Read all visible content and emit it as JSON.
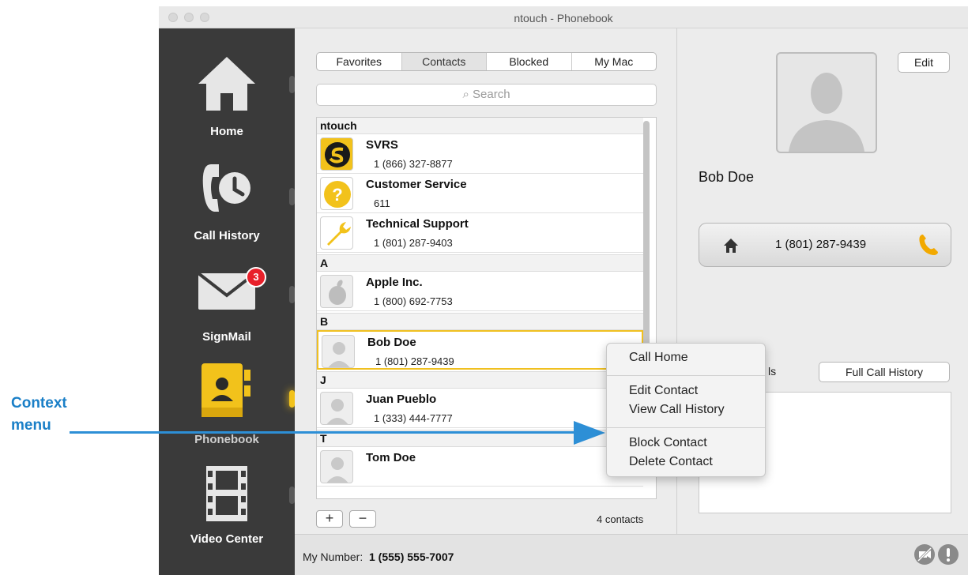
{
  "window": {
    "title": "ntouch - Phonebook"
  },
  "sidebar": {
    "items": [
      {
        "label": "Home",
        "icon": "home-icon"
      },
      {
        "label": "Call History",
        "icon": "call-history-icon"
      },
      {
        "label": "SignMail",
        "icon": "envelope-icon",
        "badge": "3"
      },
      {
        "label": "Phonebook",
        "icon": "phonebook-icon",
        "active": true
      },
      {
        "label": "Video Center",
        "icon": "film-icon"
      }
    ]
  },
  "tabs": [
    "Favorites",
    "Contacts",
    "Blocked",
    "My Mac"
  ],
  "search": {
    "placeholder": "Search",
    "icon": "magnifier-icon"
  },
  "sections": [
    {
      "header": "ntouch",
      "contacts": [
        {
          "name": "SVRS",
          "number": "1 (866) 327-8877",
          "icon": "svrs-logo-icon"
        },
        {
          "name": "Customer Service",
          "number": "611",
          "icon": "question-icon"
        },
        {
          "name": "Technical Support",
          "number": "1 (801) 287-9403",
          "icon": "wrench-icon"
        }
      ]
    },
    {
      "header": "A",
      "contacts": [
        {
          "name": "Apple Inc.",
          "number": "1 (800) 692-7753",
          "icon": "apple-logo-icon"
        }
      ]
    },
    {
      "header": "B",
      "contacts": [
        {
          "name": "Bob Doe",
          "number": "1 (801) 287-9439",
          "icon": "person-silhouette-icon",
          "selected": true
        }
      ]
    },
    {
      "header": "J",
      "contacts": [
        {
          "name": "Juan Pueblo",
          "number": "1 (333) 444-7777",
          "icon": "person-silhouette-icon"
        }
      ]
    },
    {
      "header": "T",
      "contacts": [
        {
          "name": "Tom Doe",
          "number": "",
          "icon": "person-silhouette-icon"
        }
      ]
    }
  ],
  "list_footer": {
    "add": "+",
    "remove": "−",
    "count": "4 contacts"
  },
  "details": {
    "edit": "Edit",
    "name": "Bob Doe",
    "phone_type_icon": "home-icon",
    "phone": "1 (801) 287-9439",
    "calls_label_fragment": "ls",
    "full_call_history": "Full Call History"
  },
  "status": {
    "my_number_label": "My Number:",
    "my_number": "1 (555) 555-7007"
  },
  "context_menu": {
    "items": [
      "Call Home",
      "Edit Contact",
      "View Call History",
      "Block Contact",
      "Delete Contact"
    ]
  },
  "callout": {
    "line1": "Context",
    "line2": "menu"
  },
  "colors": {
    "accent_yellow": "#f0c020",
    "callout_blue": "#1a7fc7",
    "badge_red": "#e8202a"
  }
}
